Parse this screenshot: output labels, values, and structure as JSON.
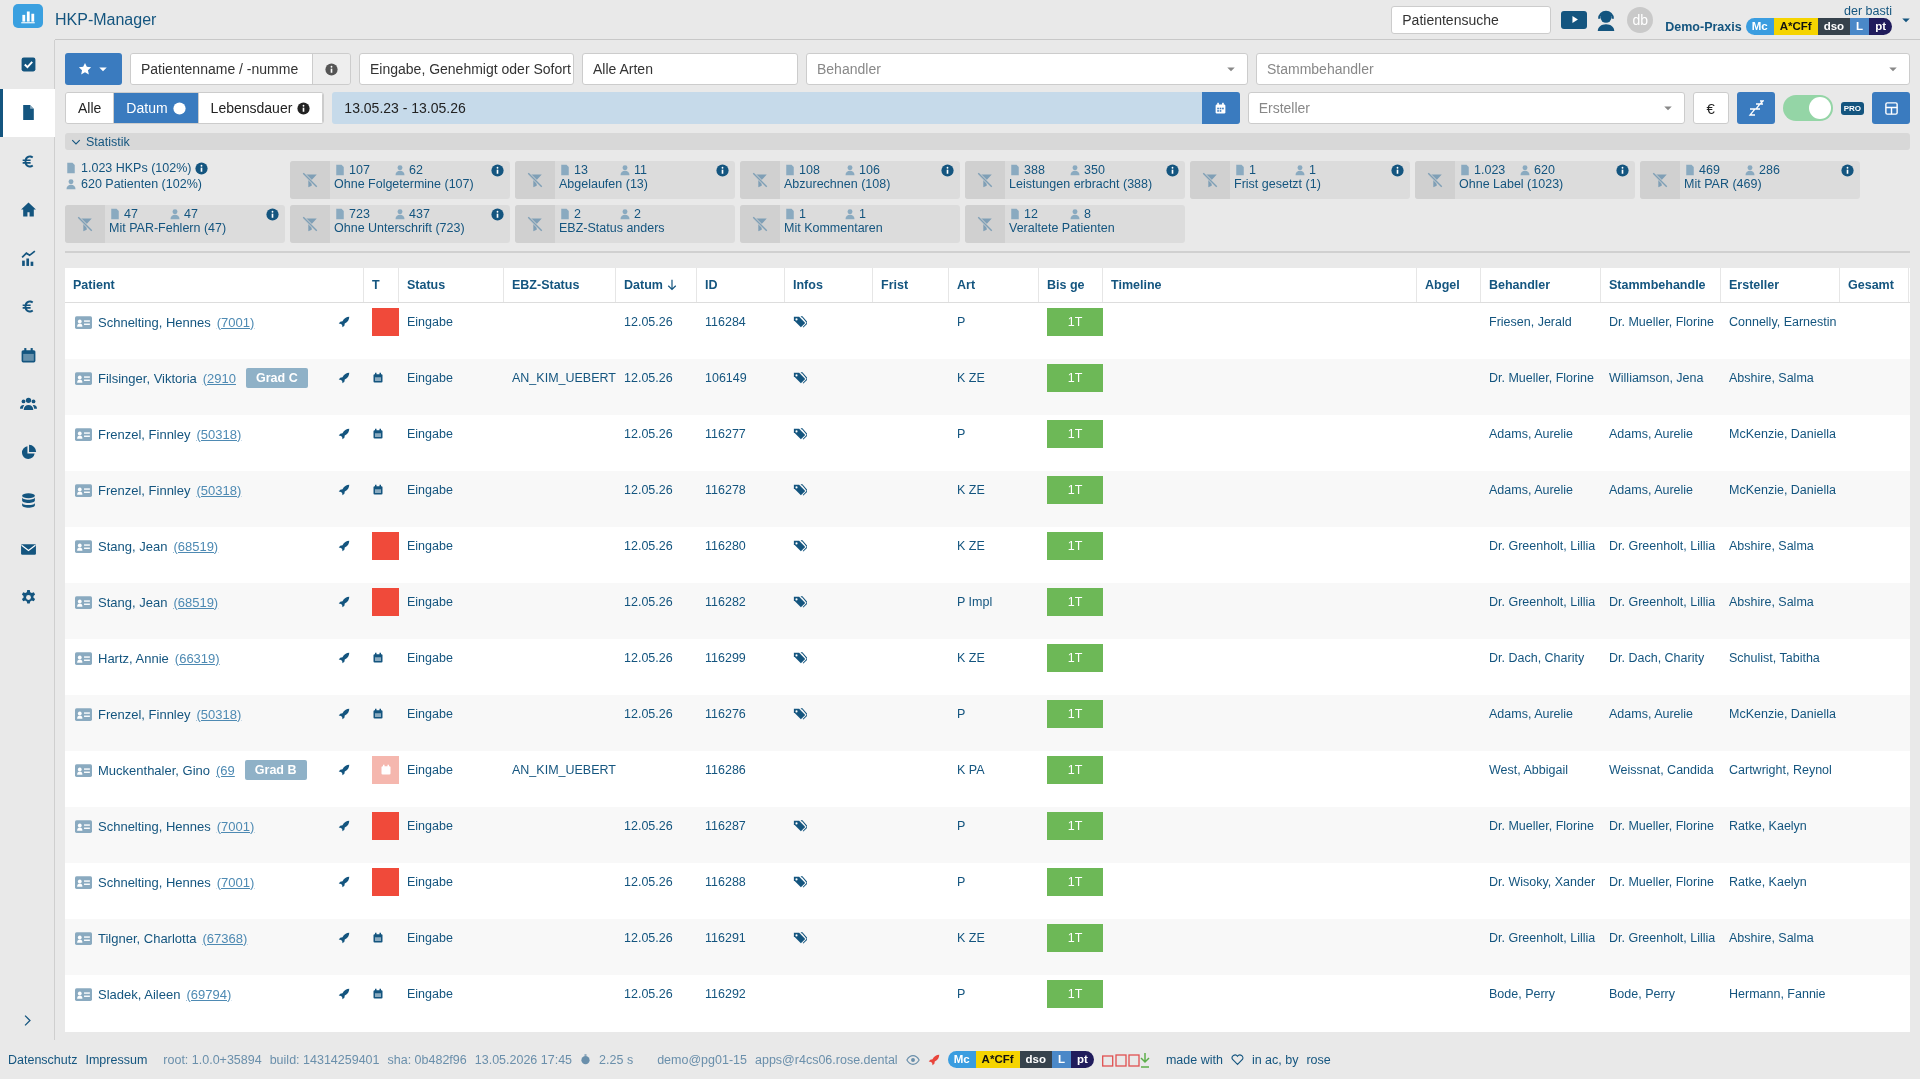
{
  "app": {
    "title": "HKP-Manager"
  },
  "header": {
    "search_placeholder": "Patientensuche",
    "avatar": "db",
    "user": "der basti",
    "practice": "Demo-Praxis",
    "badges": [
      {
        "label": "Mc",
        "color": "#3a9de0"
      },
      {
        "label": "A*CFf",
        "color": "#f5d400"
      },
      {
        "label": "dso",
        "color": "#36424c"
      },
      {
        "label": "L",
        "color": "#4a88c8"
      },
      {
        "label": "pt",
        "color": "#201c5c"
      }
    ]
  },
  "sidebar": {
    "items": [
      {
        "kind": "checkbox",
        "selected": false
      },
      {
        "kind": "document",
        "selected": true
      },
      {
        "kind": "euro",
        "selected": false
      },
      {
        "kind": "home",
        "selected": false
      },
      {
        "kind": "chart",
        "selected": false
      },
      {
        "kind": "euro",
        "selected": false
      },
      {
        "kind": "calendar",
        "selected": false
      },
      {
        "kind": "people",
        "selected": false
      },
      {
        "kind": "pie",
        "selected": false
      },
      {
        "kind": "database",
        "selected": false
      },
      {
        "kind": "mail",
        "selected": false
      },
      {
        "kind": "gear",
        "selected": false
      }
    ]
  },
  "filters": {
    "patient": {
      "placeholder": "Patientenname / -numme"
    },
    "status": {
      "value": "Eingabe, Genehmigt oder Sofort"
    },
    "types": {
      "value": "Alle Arten"
    },
    "behandler": {
      "placeholder": "Behandler"
    },
    "stammbehandler": {
      "placeholder": "Stammbehandler"
    },
    "range_tabs": [
      {
        "label": "Alle",
        "selected": false,
        "info": false
      },
      {
        "label": "Datum",
        "selected": true,
        "info": true
      },
      {
        "label": "Lebensdauer",
        "selected": false,
        "info": true
      }
    ],
    "date_range": {
      "value": "13.05.23 - 13.05.26"
    },
    "ersteller": {
      "placeholder": "Ersteller"
    },
    "currency_button": "€",
    "toggle": {
      "on": true
    },
    "pro_badge": "PRO"
  },
  "statistik": {
    "label": "Statistik",
    "expanded": true,
    "hkps": "1.023 HKPs (102%)",
    "patients": "620 Patienten (102%)",
    "cards": [
      {
        "docs": "107",
        "people": "62",
        "label": "Ohne Folgetermine (107)",
        "info": true
      },
      {
        "docs": "13",
        "people": "11",
        "label": "Abgelaufen (13)",
        "info": true
      },
      {
        "docs": "108",
        "people": "106",
        "label": "Abzurechnen (108)",
        "info": true
      },
      {
        "docs": "388",
        "people": "350",
        "label": "Leistungen erbracht (388)",
        "info": true
      },
      {
        "docs": "1",
        "people": "1",
        "label": "Frist gesetzt (1)",
        "info": true
      },
      {
        "docs": "1.023",
        "people": "620",
        "label": "Ohne Label (1023)",
        "info": true
      },
      {
        "docs": "469",
        "people": "286",
        "label": "Mit PAR (469)",
        "info": true
      },
      {
        "docs": "47",
        "people": "47",
        "label": "Mit PAR-Fehlern (47)",
        "info": true
      },
      {
        "docs": "723",
        "people": "437",
        "label": "Ohne Unterschrift (723)",
        "info": true
      },
      {
        "docs": "2",
        "people": "2",
        "label": "EBZ-Status anders",
        "info": false
      },
      {
        "docs": "1",
        "people": "1",
        "label": "Mit Kommentaren",
        "info": false
      },
      {
        "docs": "12",
        "people": "8",
        "label": "Veraltete Patienten",
        "info": false
      }
    ]
  },
  "table": {
    "columns": [
      {
        "label": "Patient",
        "sorted": false
      },
      {
        "label": "T",
        "sorted": false
      },
      {
        "label": "Status",
        "sorted": false
      },
      {
        "label": "EBZ-Status",
        "sorted": false
      },
      {
        "label": "Datum",
        "sorted": true
      },
      {
        "label": "ID",
        "sorted": false
      },
      {
        "label": "Infos",
        "sorted": false
      },
      {
        "label": "Frist",
        "sorted": false
      },
      {
        "label": "Art",
        "sorted": false
      },
      {
        "label": "Bis ge",
        "sorted": false
      },
      {
        "label": "Timeline",
        "sorted": false
      },
      {
        "label": "Abgel",
        "sorted": false
      },
      {
        "label": "Behandler",
        "sorted": false
      },
      {
        "label": "Stammbehandle",
        "sorted": false
      },
      {
        "label": "Ersteller",
        "sorted": false
      },
      {
        "label": "Gesamt",
        "sorted": false
      }
    ],
    "rows": [
      {
        "name": "Schnelting, Hennes",
        "number": "(7001)",
        "kind": "block",
        "status": "Eingabe",
        "ebz": "",
        "datum": "12.05.26",
        "id": "116284",
        "tag": true,
        "art": "P",
        "bis": "1T",
        "behandler": "Friesen, Jerald",
        "stamm": "Dr. Mueller, Florine",
        "ersteller": "Connelly, Earnestin"
      },
      {
        "name": "Filsinger, Viktoria",
        "number": "(2910",
        "grade": "Grad C",
        "kind": "calendar",
        "status": "Eingabe",
        "ebz": "AN_KIM_UEBERT",
        "datum": "12.05.26",
        "id": "106149",
        "tag": true,
        "art": "K ZE",
        "bis": "1T",
        "behandler": "Dr. Mueller, Florine",
        "stamm": "Williamson, Jena",
        "ersteller": "Abshire, Salma"
      },
      {
        "name": "Frenzel, Finnley",
        "number": "(50318)",
        "kind": "calendar",
        "status": "Eingabe",
        "ebz": "",
        "datum": "12.05.26",
        "id": "116277",
        "tag": true,
        "art": "P",
        "bis": "1T",
        "behandler": "Adams, Aurelie",
        "stamm": "Adams, Aurelie",
        "ersteller": "McKenzie, Daniella"
      },
      {
        "name": "Frenzel, Finnley",
        "number": "(50318)",
        "kind": "calendar",
        "status": "Eingabe",
        "ebz": "",
        "datum": "12.05.26",
        "id": "116278",
        "tag": true,
        "art": "K ZE",
        "bis": "1T",
        "behandler": "Adams, Aurelie",
        "stamm": "Adams, Aurelie",
        "ersteller": "McKenzie, Daniella"
      },
      {
        "name": "Stang, Jean",
        "number": "(68519)",
        "kind": "block",
        "status": "Eingabe",
        "ebz": "",
        "datum": "12.05.26",
        "id": "116280",
        "tag": true,
        "art": "K ZE",
        "bis": "1T",
        "behandler": "Dr. Greenholt, Lillia",
        "stamm": "Dr. Greenholt, Lillia",
        "ersteller": "Abshire, Salma"
      },
      {
        "name": "Stang, Jean",
        "number": "(68519)",
        "kind": "block",
        "status": "Eingabe",
        "ebz": "",
        "datum": "12.05.26",
        "id": "116282",
        "tag": true,
        "art": "P Impl",
        "bis": "1T",
        "behandler": "Dr. Greenholt, Lillia",
        "stamm": "Dr. Greenholt, Lillia",
        "ersteller": "Abshire, Salma"
      },
      {
        "name": "Hartz, Annie",
        "number": "(66319)",
        "kind": "calendar",
        "status": "Eingabe",
        "ebz": "",
        "datum": "12.05.26",
        "id": "116299",
        "tag": true,
        "art": "K ZE",
        "bis": "1T",
        "behandler": "Dr. Dach, Charity",
        "stamm": "Dr. Dach, Charity",
        "ersteller": "Schulist, Tabitha"
      },
      {
        "name": "Frenzel, Finnley",
        "number": "(50318)",
        "kind": "calendar",
        "status": "Eingabe",
        "ebz": "",
        "datum": "12.05.26",
        "id": "116276",
        "tag": true,
        "art": "P",
        "bis": "1T",
        "behandler": "Adams, Aurelie",
        "stamm": "Adams, Aurelie",
        "ersteller": "McKenzie, Daniella"
      },
      {
        "name": "Muckenthaler, Gino",
        "number": "(69",
        "grade": "Grad B",
        "kind": "faded",
        "status": "Eingabe",
        "ebz": "AN_KIM_UEBERT",
        "datum": "",
        "id": "116286",
        "tag": false,
        "art": "K PA",
        "bis": "1T",
        "behandler": "West, Abbigail",
        "stamm": "Weissnat, Candida",
        "ersteller": "Cartwright, Reynol"
      },
      {
        "name": "Schnelting, Hennes",
        "number": "(7001)",
        "kind": "block",
        "status": "Eingabe",
        "ebz": "",
        "datum": "12.05.26",
        "id": "116287",
        "tag": true,
        "art": "P",
        "bis": "1T",
        "behandler": "Dr. Mueller, Florine",
        "stamm": "Dr. Mueller, Florine",
        "ersteller": "Ratke, Kaelyn"
      },
      {
        "name": "Schnelting, Hennes",
        "number": "(7001)",
        "kind": "block",
        "status": "Eingabe",
        "ebz": "",
        "datum": "12.05.26",
        "id": "116288",
        "tag": true,
        "art": "P",
        "bis": "1T",
        "behandler": "Dr. Wisoky, Xander",
        "stamm": "Dr. Mueller, Florine",
        "ersteller": "Ratke, Kaelyn"
      },
      {
        "name": "Tilgner, Charlotta",
        "number": "(67368)",
        "kind": "calendar",
        "status": "Eingabe",
        "ebz": "",
        "datum": "12.05.26",
        "id": "116291",
        "tag": true,
        "art": "K ZE",
        "bis": "1T",
        "behandler": "Dr. Greenholt, Lillia",
        "stamm": "Dr. Greenholt, Lillia",
        "ersteller": "Abshire, Salma"
      },
      {
        "name": "Sladek, Aileen",
        "number": "(69794)",
        "kind": "calendar",
        "status": "Eingabe",
        "ebz": "",
        "datum": "12.05.26",
        "id": "116292",
        "tag": false,
        "art": "P",
        "bis": "1T",
        "behandler": "Bode, Perry",
        "stamm": "Bode, Perry",
        "ersteller": "Hermann, Fannie"
      }
    ]
  },
  "footer": {
    "links": [
      "Datenschutz",
      "Impressum"
    ],
    "meta": [
      "root: 1.0.0+35894",
      "build: 14314259401",
      "sha: 0b482f96",
      "13.05.2026 17:45"
    ],
    "duration": "2.25 s",
    "account": "demo@pg01-15",
    "host": "apps@r4cs06.rose.dental",
    "badges": [
      {
        "label": "Mc",
        "color": "#3a9de0"
      },
      {
        "label": "A*CFf",
        "color": "#f5d400"
      },
      {
        "label": "dso",
        "color": "#36424c"
      },
      {
        "label": "L",
        "color": "#4a88c8"
      },
      {
        "label": "pt",
        "color": "#201c5c"
      }
    ],
    "made_with": "made with",
    "by": "in ac, by",
    "brand": "rose"
  }
}
